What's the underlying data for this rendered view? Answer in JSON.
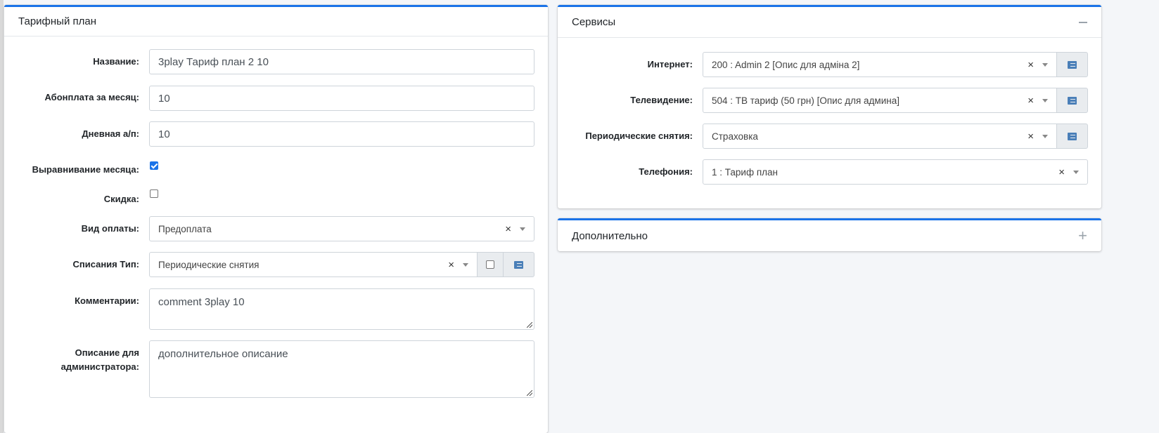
{
  "tariff_card": {
    "title": "Тарифный план",
    "fields": {
      "name": {
        "label": "Название:",
        "value": "3play Тариф план 2 10"
      },
      "monthly_fee": {
        "label": "Абонплата за месяц:",
        "value": "10"
      },
      "daily_fee": {
        "label": "Дневная а/п:",
        "value": "10"
      },
      "month_align": {
        "label": "Выравнивание месяца:",
        "checked": true
      },
      "discount": {
        "label": "Скидка:",
        "checked": false
      },
      "payment_type": {
        "label": "Вид оплаты:",
        "value": "Предоплата"
      },
      "charge_type": {
        "label": "Списания Тип:",
        "value": "Периодические снятия"
      },
      "comments": {
        "label": "Комментарии:",
        "value": "comment 3play 10"
      },
      "admin_desc": {
        "label_line1": "Описание для",
        "label_line2": "администратора:",
        "value": "дополнительное описание"
      }
    }
  },
  "services_card": {
    "title": "Сервисы",
    "fields": {
      "internet": {
        "label": "Интернет:",
        "value": "200 : Admin 2 [Опис для адміна 2]"
      },
      "tv": {
        "label": "Телевидение:",
        "value": "504 : ТВ тариф (50 грн) [Опис для админа]"
      },
      "periodic": {
        "label": "Периодические снятия:",
        "value": "Страховка"
      },
      "telephony": {
        "label": "Телефония:",
        "value": "1 : Тариф план"
      }
    }
  },
  "extra_card": {
    "title": "Дополнительно"
  },
  "icons": {
    "clear": "×",
    "collapse": "minus-icon",
    "expand": "plus-icon",
    "list": "list-icon"
  },
  "colors": {
    "accent": "#1a73e8",
    "background": "#f4f6f9"
  }
}
